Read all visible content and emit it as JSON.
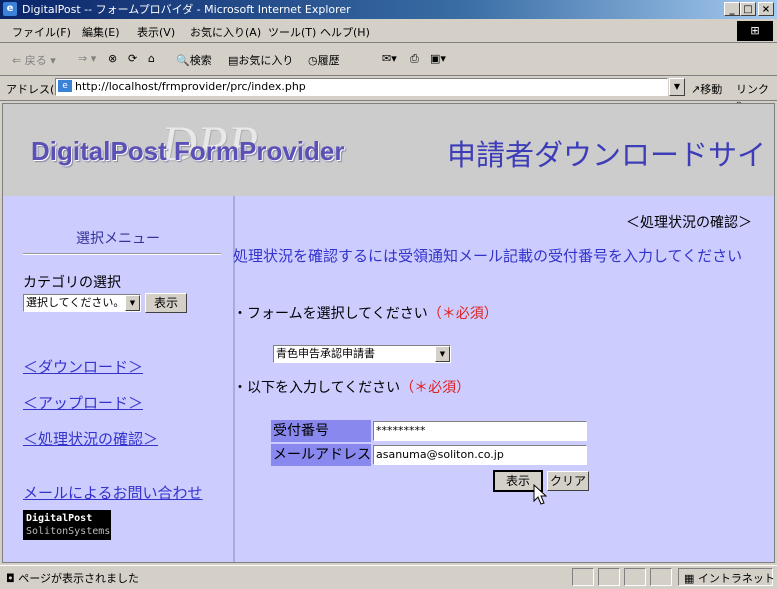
{
  "window": {
    "title": "DigitalPost -- フォームプロバイダ - Microsoft Internet Explorer",
    "minimize": "_",
    "maximize": "□",
    "close": "×"
  },
  "menu": [
    "ファイル(F)",
    "編集(E)",
    "表示(V)",
    "お気に入り(A)",
    "ツール(T)",
    "ヘルプ(H)"
  ],
  "toolbar": {
    "back": "戻る",
    "search": "検索",
    "favorites": "お気に入り",
    "history": "履歴"
  },
  "address": {
    "label": "アドレス(D)",
    "url": "http://localhost/frmprovider/prc/index.php",
    "go": "移動",
    "links": "リンク »"
  },
  "banner": {
    "logo": "DigitalPost FormProvider",
    "logo_mark": "DPP",
    "title": "申請者ダウンロードサイ"
  },
  "sidebar": {
    "title": "選択メニュー",
    "category_label": "カテゴリの選択",
    "category_select": "選択してください。",
    "show_button": "表示",
    "links": {
      "download": "＜ダウンロード＞",
      "upload": "＜アップロード＞",
      "status": "＜処理状況の確認＞",
      "contact": "メールによるお問い合わせ"
    },
    "badge_line1": "DigitalPost",
    "badge_line2": "SolitonSystems"
  },
  "main": {
    "heading": "＜処理状況の確認＞",
    "intro": "処理状況を確認するには受領通知メール記載の受付番号を入力してください",
    "form_prompt": "・フォームを選択してください",
    "input_prompt": "・以下を入力してください",
    "required": "（＊必須）",
    "form_select": "青色申告承認申請書",
    "receipt_label": "受付番号",
    "receipt_value": "*********",
    "email_label": "メールアドレス",
    "email_value": "asanuma@soliton.co.jp",
    "show_button": "表示",
    "clear_button": "クリア"
  },
  "status": {
    "text": "ページが表示されました",
    "zone": "イントラネット"
  },
  "colors": {
    "content_bg": "#ccccff",
    "link": "#3333cc",
    "required": "#e02020",
    "label_bg": "#8888ee"
  }
}
